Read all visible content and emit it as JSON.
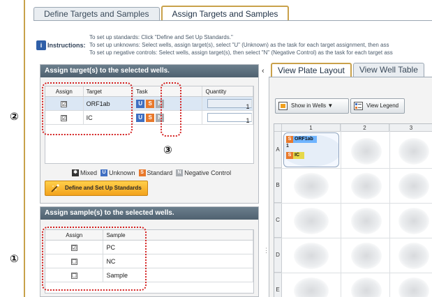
{
  "top_tabs": [
    {
      "label": "Define Targets and Samples",
      "active": false
    },
    {
      "label": "Assign Targets and Samples",
      "active": true
    }
  ],
  "instructions": {
    "label": "Instructions:",
    "lines": [
      "To set up standards: Click \"Define and Set Up Standards.\"",
      "To set up unknowns: Select wells, assign target(s), select \"U\" (Unknown) as the task for each target assignment, then ass",
      "To set up negative controls: Select wells, assign target(s), then select \"N\" (Negative Control) as the task for each target ass"
    ]
  },
  "targets_panel": {
    "title": "Assign target(s) to the selected wells.",
    "columns": [
      "Assign",
      "Target",
      "Task",
      "Quantity"
    ],
    "rows": [
      {
        "assign": "☑",
        "target": "ORF1ab",
        "quantity": "1",
        "selected": true
      },
      {
        "assign": "☑",
        "target": "IC",
        "quantity": "1",
        "selected": false
      }
    ],
    "task_buttons": [
      "U",
      "S",
      "N"
    ],
    "legend": [
      {
        "label": "Mixed",
        "symbol": "✱"
      },
      {
        "label": "Unknown",
        "symbol": "U"
      },
      {
        "label": "Standard",
        "symbol": "S"
      },
      {
        "label": "Negative Control",
        "symbol": "N"
      }
    ],
    "define_button": "Define and Set Up Standards"
  },
  "samples_panel": {
    "title": "Assign sample(s) to the selected wells.",
    "columns": [
      "Assign",
      "Sample"
    ],
    "rows": [
      {
        "assign": "☑",
        "sample": "PC"
      },
      {
        "assign": "☐",
        "sample": "NC"
      },
      {
        "assign": "☐",
        "sample": "Sample"
      }
    ]
  },
  "annotations": {
    "one": "①",
    "two": "②",
    "three": "③"
  },
  "right": {
    "collapse_arrow": "‹",
    "tabs": [
      {
        "label": "View Plate Layout",
        "active": true
      },
      {
        "label": "View Well Table",
        "active": false
      }
    ],
    "show_in_wells": "Show in Wells ▼",
    "view_legend": "View Legend",
    "columns": [
      "1",
      "2",
      "3"
    ],
    "rows": [
      "A",
      "B",
      "C",
      "D",
      "E"
    ],
    "wellA1": {
      "target1": "ORF1ab",
      "qty": "1",
      "target2": "IC",
      "task": "S"
    }
  },
  "colors": {
    "unknown": "#3f6fc2",
    "standard": "#e8792c",
    "negative": "#a9adb2",
    "highlight": "#d42020",
    "panel_header": "#5a6c7a",
    "active_tab_border": "#c9a14a"
  }
}
